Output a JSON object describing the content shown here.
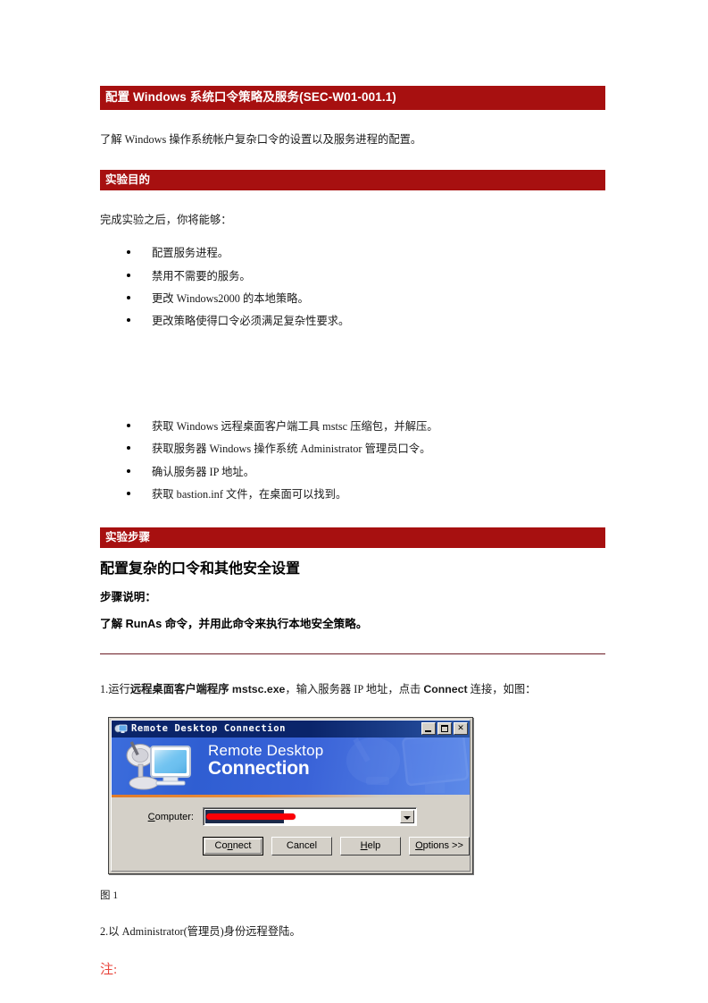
{
  "document": {
    "title_bar": "配置 Windows 系统口令策略及服务(SEC-W01-001.1)",
    "intro": "了解 Windows 操作系统帐户复杂口令的设置以及服务进程的配置。",
    "section_objectives_bar": "实验目的",
    "objectives_lead": "完成实验之后，你将能够：",
    "objectives": [
      "配置服务进程。",
      "禁用不需要的服务。",
      "更改 Windows2000 的本地策略。",
      "更改策略使得口令必须满足复杂性要求。"
    ],
    "prereqs": [
      "获取 Windows 远程桌面客户端工具 mstsc 压缩包，并解压。",
      "获取服务器 Windows 操作系统 Administrator 管理员口令。",
      "确认服务器 IP 地址。",
      "获取 bastion.inf 文件，在桌面可以找到。"
    ],
    "section_steps_bar": "实验步骤",
    "steps_heading": "配置复杂的口令和其他安全设置",
    "steps_note_label": "步骤说明：",
    "steps_note_body": "了解 RunAs 命令，并用此命令来执行本地安全策略。",
    "step1": {
      "prefix": "1.运行",
      "bold1": "远程桌面客户端程序 mstsc.exe",
      "mid": "，输入服务器 IP 地址，点击 ",
      "bold2": "Connect",
      "suffix": " 连接，如图："
    },
    "figure_caption": "图 1",
    "step2": "2.以 Administrator(管理员)身份远程登陆。",
    "note_label": "注:"
  },
  "rdp_dialog": {
    "window_title": "Remote Desktop Connection",
    "titlebar_icon": "remote-desktop-icon",
    "minimize_tooltip": "Minimize",
    "maximize_tooltip": "Maximize",
    "close_glyph": "✕",
    "banner_line1": "Remote Desktop",
    "banner_line2": "Connection",
    "computer_label_prefix": "C",
    "computer_label_rest": "omputer:",
    "computer_value": "",
    "computer_value_redacted": true,
    "dropdown_icon": "chevron-down-icon",
    "buttons": [
      {
        "pre": "Co",
        "key": "n",
        "post": "nect",
        "name": "connect-button",
        "default": true
      },
      {
        "pre": "Cancel",
        "key": "",
        "post": "",
        "name": "cancel-button",
        "default": false
      },
      {
        "pre": "",
        "key": "H",
        "post": "elp",
        "name": "help-button",
        "default": false
      },
      {
        "pre": "",
        "key": "O",
        "post": "ptions >>",
        "name": "options-button",
        "default": false
      }
    ]
  },
  "colors": {
    "header_bar": "#A71010",
    "note_red": "#E8453C",
    "rule": "#6B1C24",
    "dialog_face": "#D4D0C8",
    "titlebar_blue": "#0A246A",
    "banner_blue": "#3C6DDC",
    "redaction_red": "#FB0007"
  }
}
